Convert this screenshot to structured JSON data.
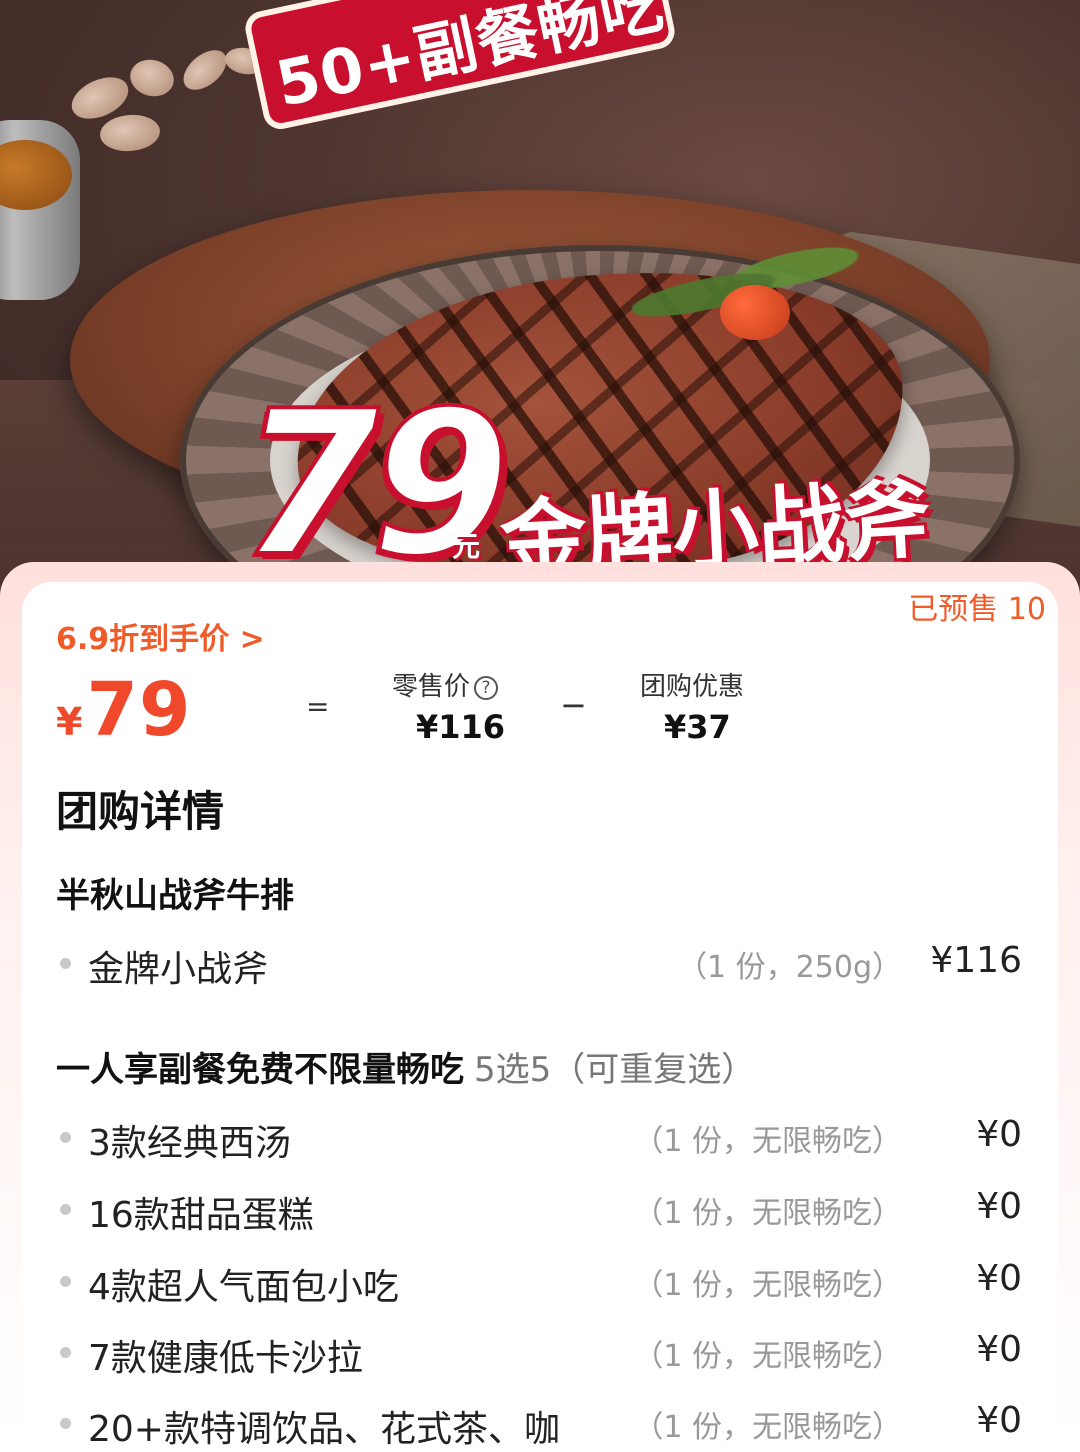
{
  "hero": {
    "badge": "50+副餐畅吃",
    "price": "79",
    "price_unit": "元",
    "title": "金牌小战斧"
  },
  "price_panel": {
    "presale": "已预售 10",
    "discount_link": "6.9折到手价 >",
    "currency": "¥",
    "final_price": "79",
    "equals": "=",
    "minus": "−",
    "retail_label": "零售价",
    "retail_value": "¥116",
    "group_discount_label": "团购优惠",
    "group_discount_value": "¥37",
    "help_icon": "question-circle-icon"
  },
  "details": {
    "title": "团购详情",
    "sections": [
      {
        "title": "半秋山战斧牛排",
        "note": "",
        "items": [
          {
            "name": "金牌小战斧",
            "qty": "（1 份，250g）",
            "price": "¥116"
          }
        ]
      },
      {
        "title": "一人享副餐免费不限量畅吃",
        "note": "5选5（可重复选）",
        "items": [
          {
            "name": "3款经典西汤",
            "qty": "（1 份，无限畅吃）",
            "price": "¥0"
          },
          {
            "name": "16款甜品蛋糕",
            "qty": "（1 份，无限畅吃）",
            "price": "¥0"
          },
          {
            "name": "4款超人气面包小吃",
            "qty": "（1 份，无限畅吃）",
            "price": "¥0"
          },
          {
            "name": "7款健康低卡沙拉",
            "qty": "（1 份，无限畅吃）",
            "price": "¥0"
          },
          {
            "name": "20+款特调饮品、花式茶、咖",
            "qty": "（1 份，无限畅吃）",
            "price": "¥0"
          }
        ]
      }
    ]
  },
  "colors": {
    "accent": "#f0482a",
    "brand_red": "#c8102e",
    "muted": "#999999"
  }
}
